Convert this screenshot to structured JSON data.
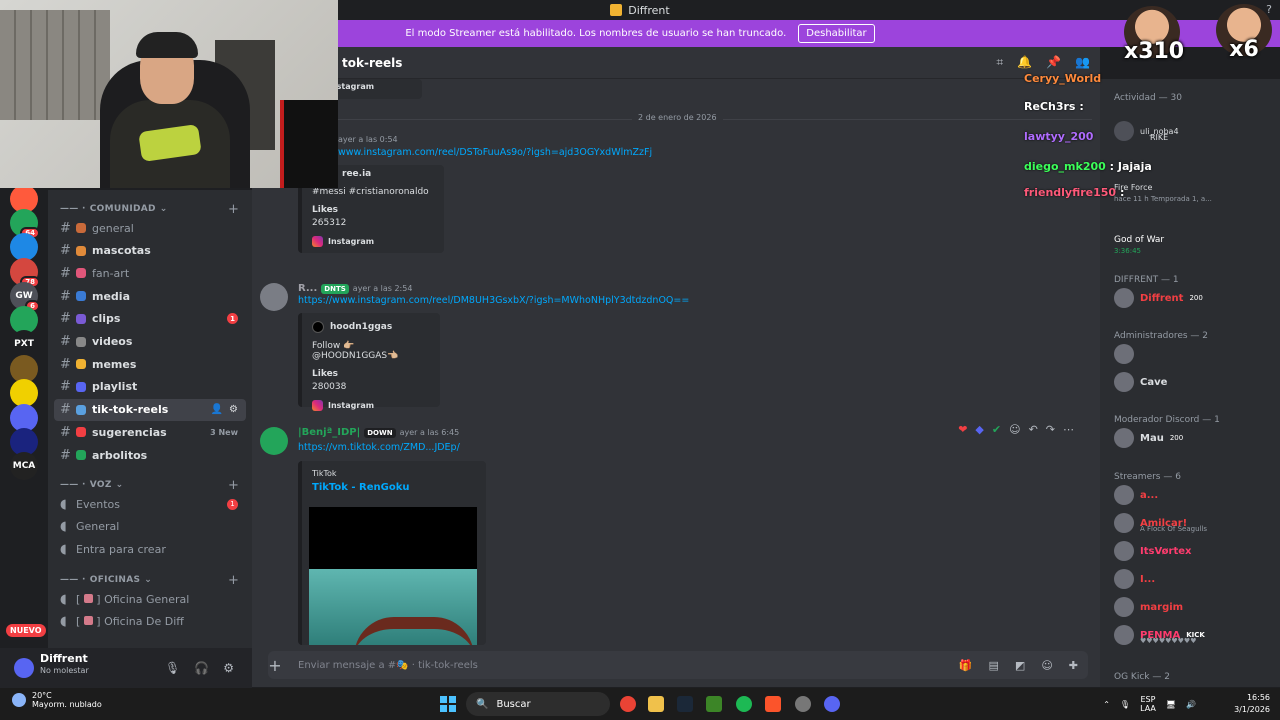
{
  "window": {
    "title": "Diffrent"
  },
  "banner": {
    "text": "El modo Streamer está habilitado. Los nombres de usuario se han truncado.",
    "button": "Deshabilitar"
  },
  "servers": [
    {
      "label": "",
      "badge": "",
      "color": "#3a7bd5"
    },
    {
      "label": "",
      "badge": "",
      "color": "#e04f5f"
    },
    {
      "label": "",
      "badge": "",
      "color": "#ff5a3c"
    },
    {
      "label": "",
      "badge": "64",
      "color": "#23a55a"
    },
    {
      "label": "",
      "badge": "",
      "color": "#1e88e5"
    },
    {
      "label": "",
      "badge": "78",
      "color": "#d4473f"
    },
    {
      "label": "GW",
      "badge": "6",
      "color": "#4e5058"
    },
    {
      "label": "",
      "badge": "",
      "color": "#23a55a"
    },
    {
      "label": "PXT",
      "badge": "",
      "color": "#1e1f22"
    },
    {
      "label": "",
      "badge": "",
      "color": "#7a5a20"
    },
    {
      "label": "",
      "badge": "",
      "color": "#f0d000"
    },
    {
      "label": "",
      "badge": "",
      "color": "#5865f2"
    },
    {
      "label": "",
      "badge": "",
      "color": "#1a237e"
    },
    {
      "label": "MCA",
      "badge": "",
      "color": "#222"
    }
  ],
  "new_badge": "NUEVO",
  "categories": {
    "comunidad": "COMUNIDAD",
    "voz": "VOZ",
    "oficinas": "OFICINAS"
  },
  "channels": [
    {
      "name": "general",
      "style": "dim"
    },
    {
      "name": "mascotas",
      "style": ""
    },
    {
      "name": "fan-art",
      "style": "dim"
    },
    {
      "name": "media",
      "style": ""
    },
    {
      "name": "clips",
      "style": "",
      "badge": "1"
    },
    {
      "name": "videos",
      "style": ""
    },
    {
      "name": "memes",
      "style": ""
    },
    {
      "name": "playlist",
      "style": ""
    },
    {
      "name": "tik-tok-reels",
      "style": "sel"
    },
    {
      "name": "sugerencias",
      "style": "",
      "newtxt": "3 New"
    },
    {
      "name": "arbolitos",
      "style": ""
    }
  ],
  "voice_channels": [
    {
      "name": "Eventos",
      "badge": "1"
    },
    {
      "name": "General",
      "badge": ""
    },
    {
      "name": "Entra para crear",
      "badge": ""
    }
  ],
  "office_channels": [
    "Oficina General",
    "Oficina De Diff"
  ],
  "user": {
    "name": "Diffrent",
    "status": "No molestar"
  },
  "chat": {
    "channel_title": "tok-reels",
    "date_divider": "2 de enero de 2026",
    "top_embed_footer": "Instagram",
    "messages": [
      {
        "time": "ayer a las 0:54",
        "link": "www.instagram.com/reel/DSToFuuAs9o/?igsh=ajd3OGYxdWlmZzFj",
        "embed": {
          "author": "ree.ia",
          "desc": "#messi #cristianoronaldo",
          "label": "Likes",
          "value": "265312",
          "footer": "Instagram"
        }
      },
      {
        "user": "R...",
        "tag": "DNTS",
        "time": "ayer a las 2:54",
        "link": "https://www.instagram.com/reel/DM8UH3GsxbX/?igsh=MWhoNHplY3dtdzdnOQ==",
        "embed": {
          "author": "hoodn1ggas",
          "desc": "Follow 👉🏼 @HOODN1GGAS👈🏼",
          "label": "Likes",
          "value": "280038",
          "footer": "Instagram"
        }
      },
      {
        "user": "|Benjª_IDP|",
        "tag": "DOWN",
        "time": "ayer a las 6:45",
        "link": "https://vm.tiktok.com/ZMD...JDEp/",
        "embed": {
          "provider": "TikTok",
          "title": "TikTok - RenGoku"
        }
      }
    ],
    "composer_placeholder": "Enviar mensaje a #🎭 · tik-tok-reels"
  },
  "chat_overlay": [
    {
      "user": "Ceryy_World",
      "text": "",
      "color": "#ff8a3c"
    },
    {
      "user": "ReCh3rs",
      "text": ":",
      "color": "#ffffff"
    },
    {
      "user": "lawtyy_200",
      "text": "",
      "color": "#b06cff"
    },
    {
      "user": "diego_mk200",
      "text": ": Jajaja",
      "color": "#3cff5a"
    },
    {
      "user": "friendlyfire150",
      "text": ":",
      "color": "#ff5a7a"
    }
  ],
  "sub_counts": [
    "x310",
    "x6"
  ],
  "members": {
    "activity_label": "Actividad — 30",
    "activities": [
      "uli_noba4",
      "RIKE",
      "Fire Force"
    ],
    "activity_sub": "hace 11 h   Temporada 1, a...",
    "game": {
      "name": "God of War",
      "time": "3:36:45"
    },
    "groups": [
      {
        "title": "DIFFRENT — 1",
        "members": [
          {
            "name": "Diffrent",
            "badge": "200",
            "color": "#f23f43"
          }
        ]
      },
      {
        "title": "Administradores — 2",
        "members": [
          {
            "name": "",
            "badge": "",
            "color": "#b58cff"
          },
          {
            "name": "Cave",
            "badge": "",
            "color": "#dbdee1"
          }
        ]
      },
      {
        "title": "Moderador Discord — 1",
        "members": [
          {
            "name": "Mau",
            "badge": "200",
            "color": "#dbdee1"
          }
        ]
      },
      {
        "title": "Streamers — 6",
        "members": [
          {
            "name": "a...",
            "color": "#f23f43",
            "sub": ""
          },
          {
            "name": "Amilcar!",
            "color": "#f23f43",
            "sub": "A Flock Of Seagulls"
          },
          {
            "name": "ItsVørtex",
            "color": "#ff3c6e",
            "sub": ""
          },
          {
            "name": "I...",
            "color": "#f23f43",
            "sub": ""
          },
          {
            "name": "margim",
            "color": "#f23f43",
            "sub": ""
          },
          {
            "name": "PENMA",
            "color": "#ff3c6e",
            "sub": "♥♥♥♥♥♥♥♥♥",
            "extra": "KICK"
          }
        ]
      },
      {
        "title": "OG Kick — 2",
        "members": []
      }
    ]
  },
  "taskbar": {
    "temp": "20°C",
    "weather": "Mayorm. nublado",
    "search": "Buscar",
    "lang1": "ESP",
    "lang2": "LAA",
    "time": "16:56",
    "date": "3/1/2026"
  }
}
